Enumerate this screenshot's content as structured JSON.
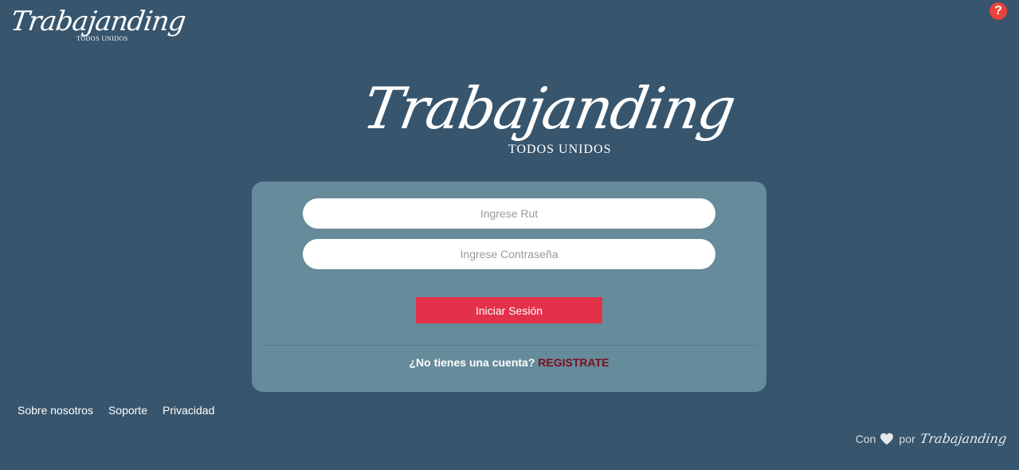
{
  "header": {
    "logo_text": "Trabajanding",
    "logo_tagline": "TODOS UNIDOS",
    "help_label": "?"
  },
  "hero": {
    "logo_text": "Trabajanding",
    "logo_tagline": "TODOS UNIDOS"
  },
  "login": {
    "rut_placeholder": "Ingrese Rut",
    "password_placeholder": "Ingrese Contraseña",
    "submit_label": "Iniciar Sesión",
    "register_prompt": "¿No tienes una cuenta?",
    "register_link": "REGISTRATE"
  },
  "footer": {
    "links": [
      "Sobre nosotros",
      "Soporte",
      "Privacidad"
    ],
    "credit_prefix": "Con",
    "credit_icon": "heart-icon",
    "credit_middle": "por",
    "credit_brand": "Trabajanding"
  },
  "colors": {
    "background": "#37556c",
    "card": "#668b9a",
    "primary_button": "#e3314a",
    "register_link": "#7a0e1d",
    "help_badge": "#e8433a"
  }
}
